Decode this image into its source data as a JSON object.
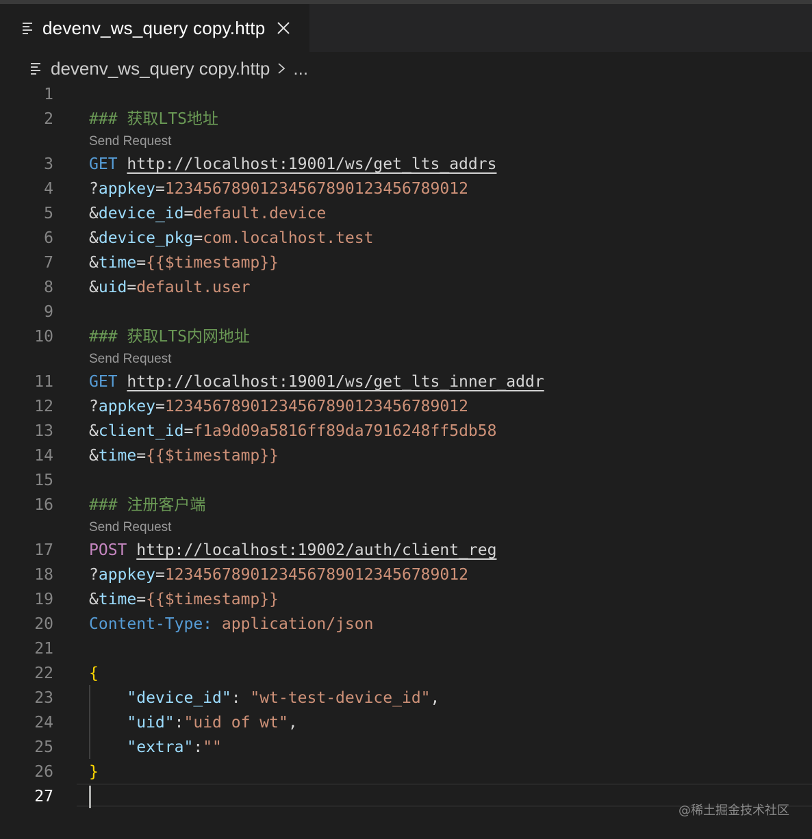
{
  "tab": {
    "title": "devenv_ws_query copy.http",
    "icon": "lines-file-icon"
  },
  "breadcrumb": {
    "file": "devenv_ws_query copy.http",
    "more": "..."
  },
  "colors": {
    "background": "#1e1e1e",
    "comment": "#6a9955",
    "method": "#569cd6",
    "post_method": "#c586c0",
    "param_key": "#9cdcfe",
    "param_value": "#ce9178",
    "brace": "#ffd700"
  },
  "editor": {
    "line_numbers": [
      "1",
      "2",
      "3",
      "4",
      "5",
      "6",
      "7",
      "8",
      "9",
      "10",
      "11",
      "12",
      "13",
      "14",
      "15",
      "16",
      "17",
      "18",
      "19",
      "20",
      "21",
      "22",
      "23",
      "24",
      "25",
      "26",
      "27"
    ],
    "codelens": "Send Request",
    "l2": {
      "comment": "### 获取LTS地址"
    },
    "l3": {
      "method": "GET",
      "url": "http://localhost:19001/ws/get_lts_addrs"
    },
    "l4": {
      "pre": "?",
      "key": "appkey",
      "eq": "=",
      "value": "12345678901234567890123456789012"
    },
    "l5": {
      "pre": "&",
      "key": "device_id",
      "eq": "=",
      "value": "default.device"
    },
    "l6": {
      "pre": "&",
      "key": "device_pkg",
      "eq": "=",
      "value": "com.localhost.test"
    },
    "l7": {
      "pre": "&",
      "key": "time",
      "eq": "=",
      "value": "{{$timestamp}}"
    },
    "l8": {
      "pre": "&",
      "key": "uid",
      "eq": "=",
      "value": "default.user"
    },
    "l10": {
      "comment": "### 获取LTS内网地址"
    },
    "l11": {
      "method": "GET",
      "url": "http://localhost:19001/ws/get_lts_inner_addr"
    },
    "l12": {
      "pre": "?",
      "key": "appkey",
      "eq": "=",
      "value": "12345678901234567890123456789012"
    },
    "l13": {
      "pre": "&",
      "key": "client_id",
      "eq": "=",
      "value": "f1a9d09a5816ff89da7916248ff5db58"
    },
    "l14": {
      "pre": "&",
      "key": "time",
      "eq": "=",
      "value": "{{$timestamp}}"
    },
    "l16": {
      "comment": "### 注册客户端"
    },
    "l17": {
      "method": "POST",
      "url": "http://localhost:19002/auth/client_reg"
    },
    "l18": {
      "pre": "?",
      "key": "appkey",
      "eq": "=",
      "value": "12345678901234567890123456789012"
    },
    "l19": {
      "pre": "&",
      "key": "time",
      "eq": "=",
      "value": "{{$timestamp}}"
    },
    "l20": {
      "header": "Content-Type:",
      "value": "application/json"
    },
    "l22": {
      "brace": "{"
    },
    "l23": {
      "key": "\"device_id\"",
      "sep": ": ",
      "value": "\"wt-test-device_id\"",
      "tail": ","
    },
    "l24": {
      "key": "\"uid\"",
      "sep": ":",
      "value": "\"uid of wt\"",
      "tail": ","
    },
    "l25": {
      "key": "\"extra\"",
      "sep": ":",
      "value": "\"\""
    },
    "l26": {
      "brace": "}"
    }
  },
  "watermark": "@稀土掘金技术社区"
}
